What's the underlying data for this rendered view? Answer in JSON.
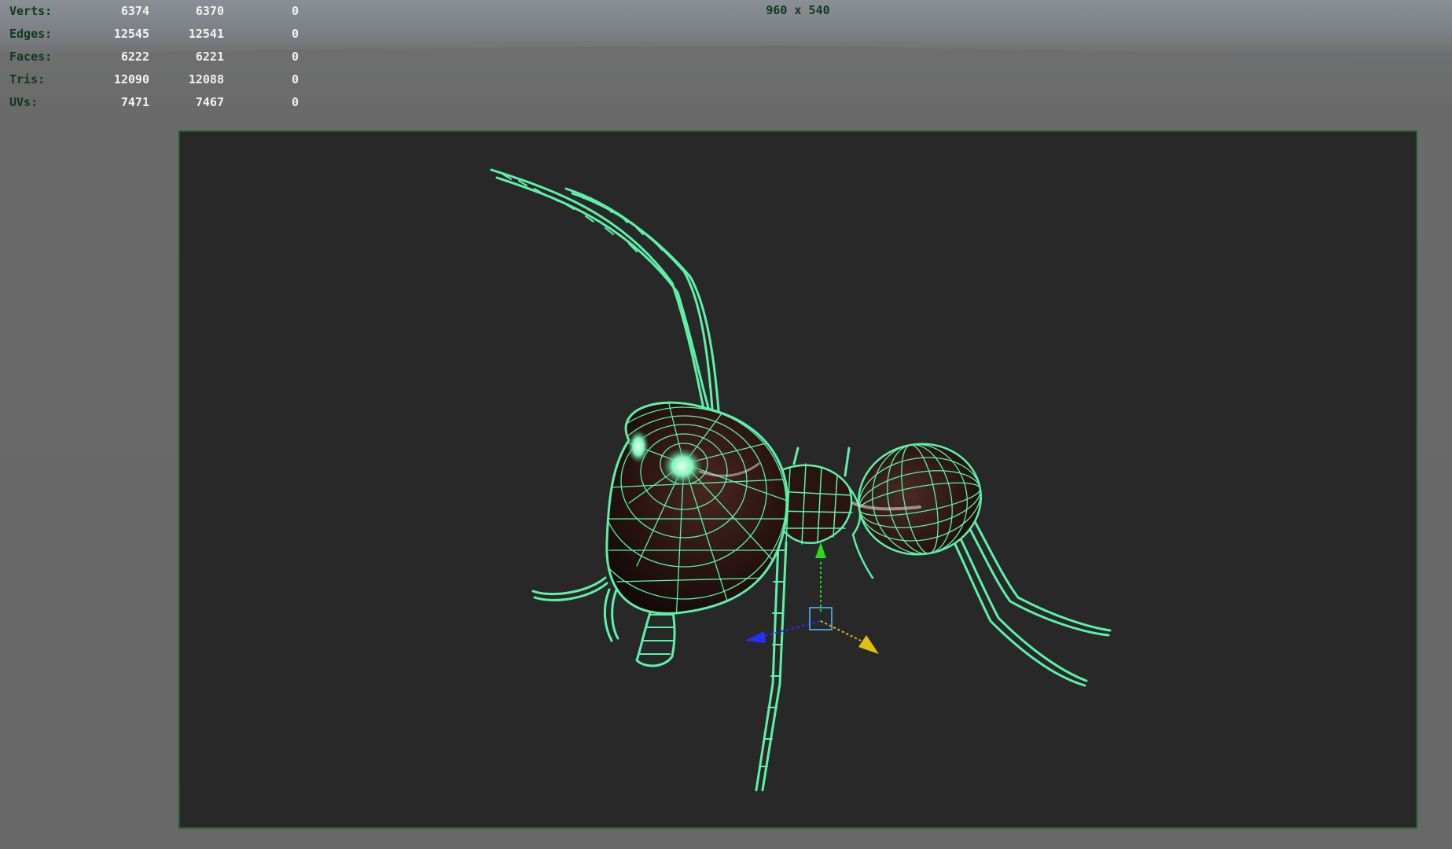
{
  "stats": [
    {
      "label": "Verts:",
      "values": [
        "6374",
        "6370",
        "0"
      ]
    },
    {
      "label": "Edges:",
      "values": [
        "12545",
        "12541",
        "0"
      ]
    },
    {
      "label": "Faces:",
      "values": [
        "6222",
        "6221",
        "0"
      ]
    },
    {
      "label": "Tris:",
      "values": [
        "12090",
        "12088",
        "0"
      ]
    },
    {
      "label": "UVs:",
      "values": [
        "7471",
        "7467",
        "0"
      ]
    }
  ],
  "resolution": "960 x 540",
  "colors": {
    "wireframe": "#5ff0a8",
    "body": "#2a1412",
    "gate_border": "#1e5a2a",
    "hud_label": "#0f3a1c",
    "hud_value": "#f2f2f2"
  },
  "manipulator": {
    "y_axis_color": "#22dd22",
    "x_axis_color": "#2030ff",
    "z_axis_color": "#e0c010",
    "icon": "move-manipulator-icon"
  }
}
